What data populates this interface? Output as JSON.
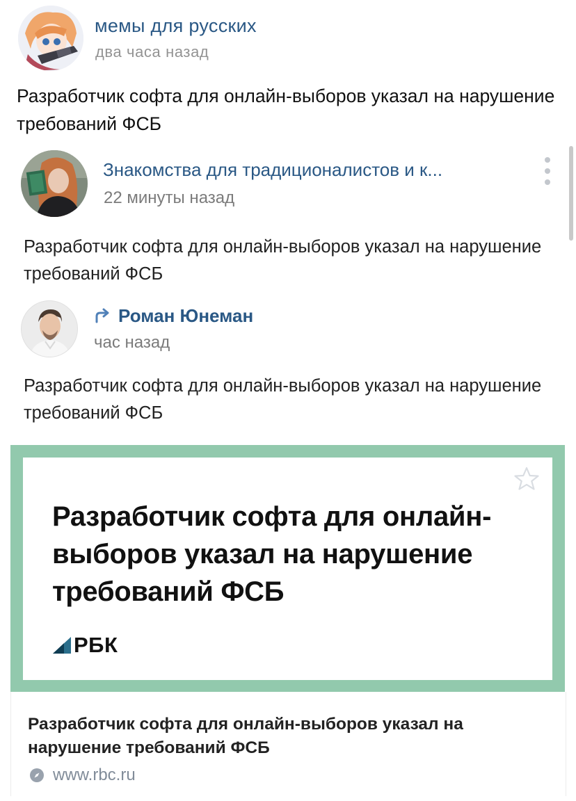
{
  "outer_post": {
    "author": "мемы для русских",
    "time": "два часа назад",
    "text": "Разработчик софта для онлайн-выборов указал на нарушение требований ФСБ"
  },
  "shared_post": {
    "author": "Знакомства для традиционалистов и к...",
    "time": "22 минуты назад",
    "text": "Разработчик софта для онлайн-выборов указал на нарушение требований ФСБ"
  },
  "repost": {
    "icon": "repost-arrow-icon",
    "author": "Роман Юнеман",
    "time": "час назад",
    "text": "Разработчик софта для онлайн-выборов указал на нарушение требований ФСБ"
  },
  "link_card": {
    "headline": "Разработчик софта для онлайн-выборов указал на нарушение требований ФСБ",
    "logo_text": "РБК",
    "caption_title": "Разработчик софта для онлайн-выборов указал на нарушение требований ФСБ",
    "url": "www.rbc.ru",
    "frame_color": "#92c9ad",
    "link_color": "#2a5885"
  }
}
